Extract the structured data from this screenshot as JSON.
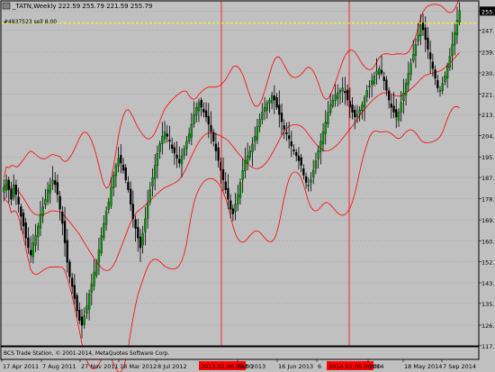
{
  "header": {
    "icon": "chart-window-icon",
    "symbol_line": "_TATN,Weekly  222.59 255.79 221.59 255.79"
  },
  "order_label": "#4837523 sell 8.00",
  "copyright": "BCS Trade Station, © 2001-2014, MetaQuotes Software Corp.",
  "colors": {
    "background": "#c0c0c0",
    "grid": "#808080",
    "candle_bull": "#00a000",
    "candle_bear": "#000000",
    "bands": "#ff0000",
    "order_line": "#ffff00",
    "vline": "#ff0000",
    "price_marker": "#000000"
  },
  "chart_data": {
    "type": "candlestick",
    "title": "_TATN,Weekly",
    "ohlc_header": {
      "open": 222.59,
      "high": 255.79,
      "low": 221.59,
      "close": 255.79
    },
    "ylim": [
      117.5,
      260.0
    ],
    "y_ticks": [
      255.79,
      247.85,
      239.05,
      230.25,
      221.55,
      213.05,
      204.3,
      195.55,
      187.05,
      178.35,
      169.55,
      160.85,
      152.3,
      143.55,
      135.05,
      126.05,
      117.55
    ],
    "x_tick_labels": [
      "17 Apr 2011",
      "7 Aug 2011",
      "27 Nov 2011",
      "18 Mar 2012",
      "8 Jul 2012",
      "2013.01.06 00:00",
      "Feb 2013",
      "16 Jun 2013",
      "6",
      "2014.01.05 00:00",
      "2014",
      "18 May 2014",
      "7 Sep 2014"
    ],
    "current_price": 255.79,
    "order_price": 250.8,
    "vertical_markers": [
      "2013.01.06 00:00",
      "2014.01.05 00:00"
    ],
    "indicator": "Bollinger Bands",
    "closes": [
      183,
      186,
      182,
      178,
      184,
      180,
      176,
      171,
      167,
      162,
      158,
      155,
      160,
      163,
      167,
      172,
      175,
      178,
      182,
      184,
      186,
      184,
      180,
      174,
      168,
      160,
      152,
      146,
      142,
      137,
      132,
      128,
      126,
      130,
      134,
      139,
      143,
      148,
      152,
      157,
      163,
      168,
      173,
      177,
      183,
      188,
      192,
      195,
      193,
      190,
      186,
      182,
      176,
      170,
      166,
      162,
      158,
      164,
      170,
      176,
      182,
      187,
      192,
      197,
      201,
      204,
      206,
      204,
      202,
      199,
      197,
      195,
      193,
      196,
      199,
      202,
      205,
      209,
      213,
      216,
      218,
      216,
      214,
      212,
      209,
      206,
      202,
      198,
      194,
      190,
      186,
      182,
      178,
      174,
      172,
      176,
      180,
      185,
      190,
      194,
      196,
      198,
      201,
      204,
      208,
      211,
      214,
      216,
      218,
      219,
      221,
      219,
      216,
      213,
      210,
      207,
      205,
      203,
      200,
      198,
      196,
      194,
      192,
      188,
      185,
      184,
      186,
      190,
      194,
      198,
      202,
      206,
      210,
      214,
      217,
      219,
      221,
      222,
      223,
      224,
      222,
      219,
      216,
      214,
      212,
      213,
      215,
      217,
      220,
      223,
      225,
      227,
      229,
      231,
      232,
      230,
      227,
      223,
      219,
      216,
      214,
      212,
      214,
      218,
      222,
      226,
      230,
      234,
      238,
      242,
      246,
      250,
      248,
      244,
      240,
      236,
      232,
      228,
      224,
      223,
      226,
      229,
      233,
      237,
      242,
      247,
      252,
      256
    ]
  }
}
